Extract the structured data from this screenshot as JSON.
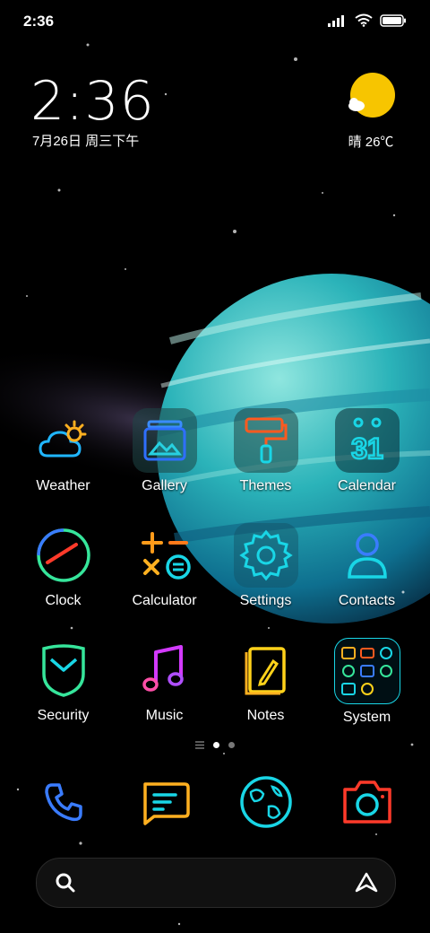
{
  "status_bar": {
    "time": "2:36"
  },
  "widget": {
    "time": "2:36",
    "date": "7月26日 周三下午"
  },
  "weather": {
    "temp": "晴 26℃"
  },
  "apps": [
    {
      "label": "Weather",
      "icon": "weather-cloud-sun-icon"
    },
    {
      "label": "Gallery",
      "icon": "gallery-icon"
    },
    {
      "label": "Themes",
      "icon": "themes-roller-icon"
    },
    {
      "label": "Calendar",
      "icon": "calendar-icon"
    },
    {
      "label": "Clock",
      "icon": "clock-icon"
    },
    {
      "label": "Calculator",
      "icon": "calculator-icon"
    },
    {
      "label": "Settings",
      "icon": "gear-icon"
    },
    {
      "label": "Contacts",
      "icon": "contacts-icon"
    },
    {
      "label": "Security",
      "icon": "shield-icon"
    },
    {
      "label": "Music",
      "icon": "music-note-icon"
    },
    {
      "label": "Notes",
      "icon": "notes-pencil-icon"
    },
    {
      "label": "System",
      "icon": "folder-icon"
    }
  ],
  "calendar_day": "31",
  "dock": [
    {
      "icon": "phone-icon"
    },
    {
      "icon": "messages-icon"
    },
    {
      "icon": "browser-globe-icon"
    },
    {
      "icon": "camera-icon"
    }
  ],
  "pages": {
    "count": 2,
    "current": 1
  },
  "colors": {
    "planet": "#2bb3b9",
    "sun": "#f7c500",
    "neon_cyan": "#19d6e6",
    "neon_orange": "#ff7a1a"
  }
}
